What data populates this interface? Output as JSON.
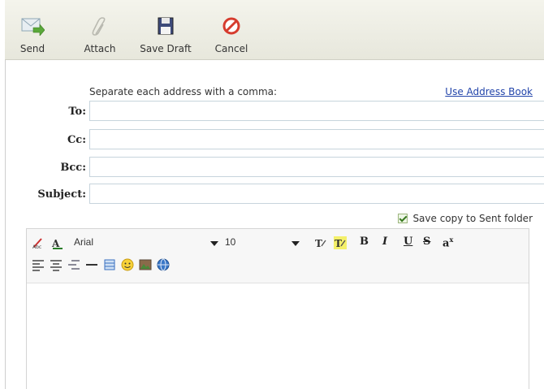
{
  "toolbar": {
    "send_label": "Send",
    "attach_label": "Attach",
    "save_draft_label": "Save Draft",
    "cancel_label": "Cancel"
  },
  "compose": {
    "hint": "Separate each address with a comma:",
    "address_book_link": "Use Address Book",
    "to_label": "To:",
    "cc_label": "Cc:",
    "bcc_label": "Bcc:",
    "subject_label": "Subject:",
    "to_value": "",
    "cc_value": "",
    "bcc_value": "",
    "subject_value": "",
    "save_copy_label": "Save copy to Sent folder",
    "save_copy_checked": true
  },
  "editor": {
    "font_family": "Arial",
    "font_size": "10",
    "bold": "B",
    "italic": "I",
    "underline": "U",
    "strike": "S",
    "superscript": "a"
  },
  "colors": {
    "link": "#2244aa",
    "field_border": "#c7d4dc",
    "toolbar_bg": "#eeeee4"
  }
}
